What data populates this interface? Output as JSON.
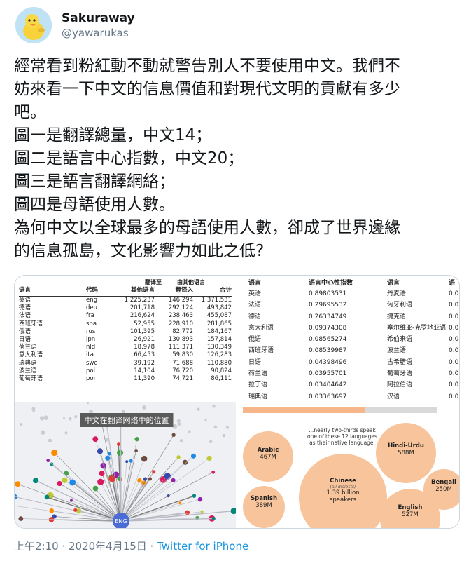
{
  "user": {
    "display_name": "Sakuraway",
    "handle": "@yawarukas",
    "avatar_icon": "duckling-avatar"
  },
  "tweet": {
    "lines": [
      "經常看到粉紅動不動就警告別人不要使用中文。我們不",
      "妨來看一下中文的信息價值和對現代文明的貢獻有多少",
      "吧。",
      "圖一是翻譯總量，中文14；",
      "圖二是語言中心指數，中文20；",
      "圖三是語言翻譯網絡；",
      "圖四是母語使用人數。",
      "為何中文以全球最多的母語使用人數，卻成了世界邊緣",
      "的信息孤島，文化影響力如此之低?"
    ]
  },
  "figure1": {
    "super_headers": [
      "翻译至",
      "由其他语言"
    ],
    "headers": [
      "语言",
      "代码",
      "其他语言",
      "翻译入",
      "合计"
    ],
    "rows": [
      [
        "英语",
        "eng",
        "1,225,237",
        "146,294",
        "1,371,531"
      ],
      [
        "德语",
        "deu",
        "201,718",
        "292,124",
        "493,842"
      ],
      [
        "法语",
        "fra",
        "216,624",
        "238,463",
        "455,087"
      ],
      [
        "西班牙语",
        "spa",
        "52,955",
        "228,910",
        "281,865"
      ],
      [
        "俄语",
        "rus",
        "101,395",
        "82,772",
        "184,167"
      ],
      [
        "日语",
        "jpn",
        "26,921",
        "130,893",
        "157,814"
      ],
      [
        "荷兰语",
        "nld",
        "18,978",
        "111,371",
        "130,349"
      ],
      [
        "意大利语",
        "ita",
        "66,453",
        "59,830",
        "126,283"
      ],
      [
        "瑞典语",
        "swe",
        "39,192",
        "71,688",
        "110,880"
      ],
      [
        "波兰语",
        "pol",
        "14,104",
        "76,720",
        "90,824"
      ],
      [
        "葡萄牙语",
        "por",
        "11,390",
        "74,721",
        "86,111"
      ]
    ]
  },
  "figure2": {
    "headers": [
      "语言",
      "语言中心性指数"
    ],
    "rows": [
      [
        "英语",
        "0.89803531"
      ],
      [
        "法语",
        "0.29695532"
      ],
      [
        "德语",
        "0.26334749"
      ],
      [
        "意大利语",
        "0.09374308"
      ],
      [
        "俄语",
        "0.08565274"
      ],
      [
        "西班牙语",
        "0.08539987"
      ],
      [
        "日语",
        "0.04398496"
      ],
      [
        "荷兰语",
        "0.03955701"
      ],
      [
        "拉丁语",
        "0.03404642"
      ],
      [
        "瑞典语",
        "0.03363697"
      ]
    ],
    "right_headers": [
      "语言",
      "语"
    ],
    "right_rows": [
      [
        "丹麦语",
        "0.0"
      ],
      [
        "匈牙利语",
        "0.0"
      ],
      [
        "捷克语",
        "0.0"
      ],
      [
        "塞尔维亚-克罗地亚语",
        "0.0"
      ],
      [
        "希伯来语",
        "0.0"
      ],
      [
        "波兰语",
        "0.0"
      ],
      [
        "古希腊语",
        "0.0"
      ],
      [
        "葡萄牙语",
        "0.0"
      ],
      [
        "阿拉伯语",
        "0.0"
      ],
      [
        "汉语",
        "0.0"
      ]
    ]
  },
  "figure3": {
    "title": "中文在翻译网络中的位置",
    "hub_label": "ENG"
  },
  "figure4": {
    "progress_fraction": 0.63,
    "caption": "...nearly two-thirds speak one of these 12 languages as their native language.",
    "bubbles": [
      {
        "name": "Arabic",
        "value": "467M"
      },
      {
        "name": "Hindi-Urdu",
        "value": "588M"
      },
      {
        "name": "Chinese",
        "note": "(all dialects)",
        "value": "1.39 billion",
        "extra": "speakers"
      },
      {
        "name": "Bengali",
        "value": "250M"
      },
      {
        "name": "Spanish",
        "value": "389M"
      },
      {
        "name": "English",
        "value": "527M"
      }
    ]
  },
  "footer": {
    "timestamp": "上午2:10 · 2020年4月15日 · ",
    "source": "Twitter for iPhone"
  },
  "colors": {
    "link": "#1b95e0",
    "bubble": "#f7c49b",
    "network_hub": "#4a6cd4"
  }
}
